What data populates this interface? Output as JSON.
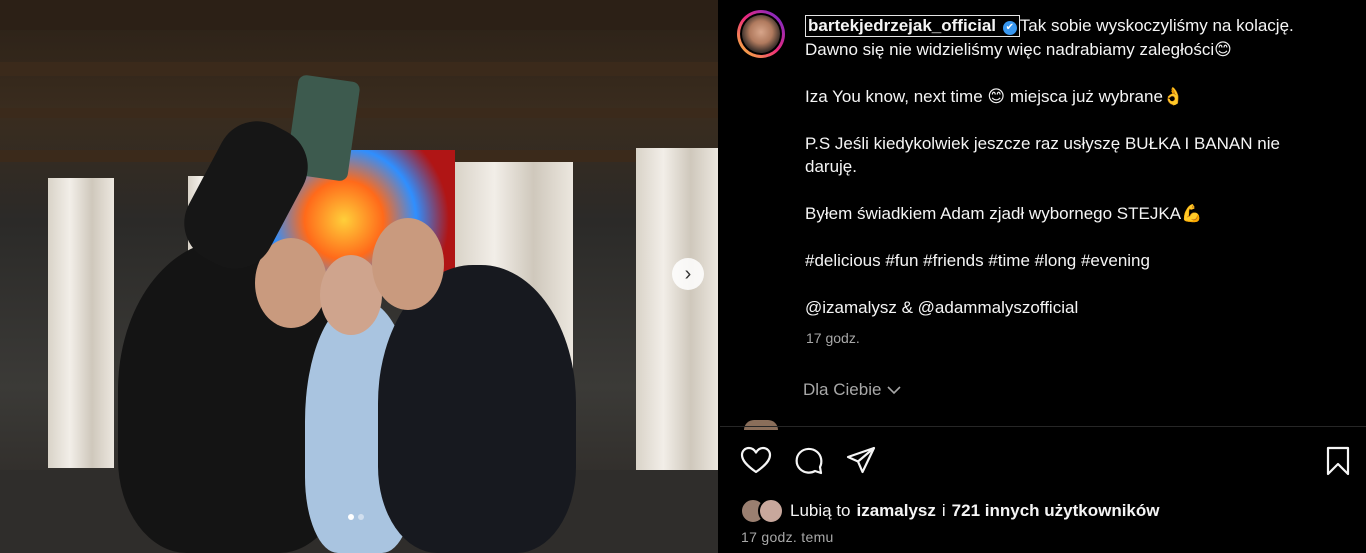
{
  "post": {
    "username": "bartekjedrzejak_official",
    "verified_badge": "✔",
    "caption": [
      "Tak sobie wyskoczyliśmy na kolację.",
      "Dawno się nie widzieliśmy więc nadrabiamy zaległości😊",
      "",
      "Iza You know, next time 😊 miejsca już wybrane👌",
      "",
      "P.S Jeśli kiedykolwiek jeszcze raz usłyszę BUŁKA I BANAN nie",
      "daruję.",
      "",
      "Byłem świadkiem Adam zjadł wybornego STEJKA💪",
      "",
      "#delicious #fun #friends #time #long #evening",
      "",
      "@izamalysz & @adammalyszofficial"
    ],
    "caption_time": "17 godz.",
    "for_you_label": "Dla Ciebie",
    "likes": {
      "prefix": "Lubią to",
      "user": "izamalysz",
      "middle": "i",
      "others": "721 innych użytkowników"
    },
    "timestamp": "17 godz. temu"
  },
  "carousel": {
    "slides": 2,
    "current": 1
  },
  "icons": {
    "like": "heart-icon",
    "comment": "comment-icon",
    "share": "share-icon",
    "save": "bookmark-icon",
    "next": "chevron-right-icon",
    "dropdown": "chevron-down-icon"
  },
  "colors": {
    "background": "#000000",
    "text": "#f5f5f5",
    "muted": "#a8a8a8",
    "verified": "#3897f0"
  }
}
